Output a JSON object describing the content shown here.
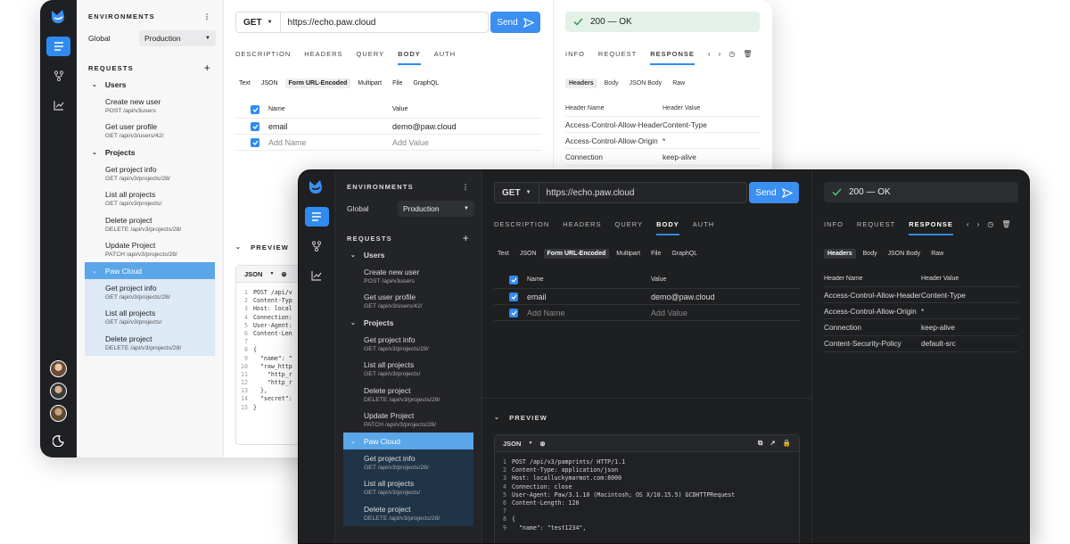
{
  "sidebar": {
    "environments_label": "ENVIRONMENTS",
    "env_name": "Global",
    "env_value": "Production",
    "requests_label": "REQUESTS",
    "groups": {
      "users": "Users",
      "projects": "Projects",
      "paw_cloud": "Paw Cloud"
    },
    "users_items": [
      {
        "name": "Create new user",
        "path": "POST /api/v3users"
      },
      {
        "name": "Get user profile",
        "path": "GET /api/v3/users/42/"
      }
    ],
    "projects_items": [
      {
        "name": "Get project info",
        "path": "GET /api/v3/projects/28/"
      },
      {
        "name": "List all projects",
        "path": "GET /api/v3/projects/"
      },
      {
        "name": "Delete project",
        "path": "DELETE /api/v3/projects/28/"
      },
      {
        "name": "Update Project",
        "path": "PATCH /api/v3/projects/28/"
      }
    ],
    "cloud_items": [
      {
        "name": "Get project info",
        "path": "GET /api/v3/projects/28/"
      },
      {
        "name": "List all projects",
        "path": "GET /api/v3/projects/"
      },
      {
        "name": "Delete project",
        "path": "DELETE /api/v3/projects/28/"
      }
    ]
  },
  "request": {
    "method": "GET",
    "url": "https://echo.paw.cloud",
    "send_label": "Send",
    "tabs": [
      "DESCRIPTION",
      "HEADERS",
      "QUERY",
      "BODY",
      "AUTH"
    ],
    "active_tab": "BODY",
    "body_types": [
      "Text",
      "JSON",
      "Form URL-Encoded",
      "Multipart",
      "File",
      "GraphQL"
    ],
    "active_body_type": "Form URL-Encoded",
    "form": {
      "col_name": "Name",
      "col_value": "Value",
      "rows": [
        {
          "name": "email",
          "value": "demo@paw.cloud"
        }
      ],
      "add_name": "Add Name",
      "add_value": "Add Value"
    },
    "preview_label": "PREVIEW",
    "preview_format": "JSON",
    "light_code": [
      "POST /api/v",
      "Content-Typ",
      "Host: local",
      "Connection:",
      "User-Agent:",
      "Content-Len",
      "",
      "{",
      "  \"name\": \"",
      "  \"raw_http",
      "    \"http_r",
      "    \"http_r",
      "  },",
      "  \"secret\":",
      "}"
    ],
    "dark_code": [
      "POST /api/v3/pamprints/ HTTP/1.1",
      "Content-Type: application/json",
      "Host: localluckymarmot.com:8000",
      "Connection: close",
      "User-Agent: Paw/3.1.10 (Macintosh; OS X/10.15.5) GCDHTTPRequest",
      "Content-Length: 120",
      "",
      "{",
      "  \"name\": \"test1234\","
    ]
  },
  "response": {
    "status": "200 — OK",
    "tabs": [
      "INFO",
      "REQUEST",
      "RESPONSE"
    ],
    "active_tab": "RESPONSE",
    "sub_tabs": [
      "Headers",
      "Body",
      "JSON Body",
      "Raw"
    ],
    "active_sub": "Headers",
    "col_name": "Header Name",
    "col_value": "Header Value",
    "headers_light": [
      {
        "name": "Access-Control-Allow-Headers",
        "value": "Content-Type"
      },
      {
        "name": "Access-Control-Allow-Origin",
        "value": "*"
      },
      {
        "name": "Connection",
        "value": "keep-alive"
      }
    ],
    "headers_dark": [
      {
        "name": "Access-Control-Allow-Headers",
        "value": "Content-Type"
      },
      {
        "name": "Access-Control-Allow-Origin",
        "value": "*"
      },
      {
        "name": "Connection",
        "value": "keep-alive"
      },
      {
        "name": "Content-Security-Policy",
        "value": "default-src"
      }
    ]
  },
  "colors": {
    "accent": "#2f8bf0",
    "rail": "#1f2024",
    "dark_bg": "#1e1f21",
    "status_ok": "#e3f1e8"
  }
}
